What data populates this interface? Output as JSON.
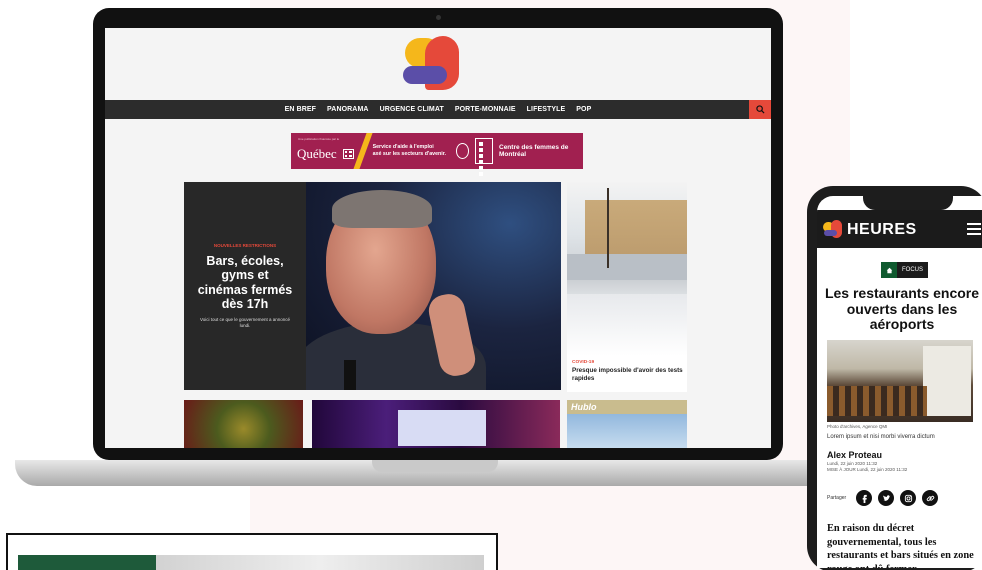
{
  "desktop_site": {
    "nav": {
      "items": [
        "EN BREF",
        "PANORAMA",
        "URGENCE CLIMAT",
        "PORTE-MONNAIE",
        "LIFESTYLE",
        "POP"
      ],
      "search_icon": "search-icon"
    },
    "ad": {
      "small_text": "Une publication financée par le",
      "quebec": "Québec",
      "line1": "Service d'aide à l'emploi",
      "line2": "axé sur les secteurs d'avenir.",
      "centre": "Centre des femmes de Montréal"
    },
    "hero": {
      "kicker": "NOUVELLES RESTRICTIONS",
      "title": "Bars, écoles, gyms et cinémas fermés dès 17h",
      "desc": "Voici tout ce que le gouvernement a annoncé lundi."
    },
    "side": {
      "kicker": "COVID-19",
      "title": "Presque impossible d'avoir des tests rapides"
    },
    "thumb_brand": "Hublo"
  },
  "mobile_site": {
    "brand": "HEURES",
    "focus_label": "FOCUS",
    "title": "Les restaurants encore ouverts dans les aéroports",
    "photo_caption": "Photo d'archives, Agence QMI",
    "lorem": "Lorem ipsum et nisi morbi viverra dictum",
    "author": "Alex Proteau",
    "date_published": "Lundi, 22 juin 2020 11:32",
    "date_updated": "MISE À JOUR Lundi, 22 juin 2020 11:32",
    "share_label": "Partager",
    "social_icons": [
      "facebook-icon",
      "twitter-icon",
      "instagram-icon",
      "link-icon"
    ],
    "body": "En raison du décret gouvernemental, tous les restaurants et bars situés en zone rouge ont dû fermer"
  },
  "colors": {
    "accent_red": "#e5493a",
    "accent_yellow": "#f5b71b",
    "accent_purple": "#5b4ea8",
    "ad_magenta": "#a12050",
    "dark_nav": "#2c2c2c",
    "focus_green": "#0f5a2f"
  }
}
